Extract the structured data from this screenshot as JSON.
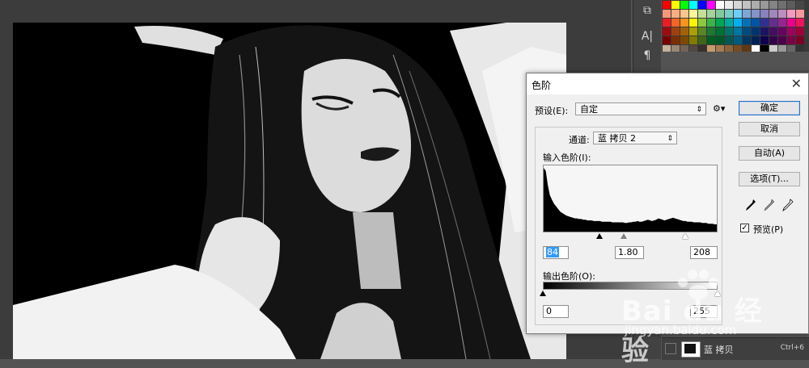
{
  "dialog": {
    "title": "色阶",
    "preset_label": "预设(E):",
    "preset_value": "自定",
    "channel_label": "通道:",
    "channel_value": "蓝 拷贝 2",
    "input_levels_label": "输入色阶(I):",
    "input_black": "84",
    "input_gamma": "1.80",
    "input_white": "208",
    "output_levels_label": "输出色阶(O):",
    "output_black": "0",
    "output_white": "255",
    "buttons": {
      "ok": "确定",
      "cancel": "取消",
      "auto": "自动(A)",
      "options": "选项(T)..."
    },
    "preview_label": "预览(P)",
    "preview_checked": true,
    "close_glyph": "✕",
    "gear_glyph": "⚙▾"
  },
  "layer": {
    "name": "蓝 拷贝",
    "shortcut": "Ctrl+6"
  },
  "watermark": {
    "brand": "Bai du 经验",
    "url": "jingyan.baidu.com"
  },
  "tools": {
    "char_icon": "A|",
    "para_icon": "¶"
  },
  "histogram": [
    96,
    92,
    70,
    55,
    48,
    42,
    38,
    34,
    30,
    28,
    26,
    24,
    23,
    22,
    21,
    20,
    20,
    19,
    19,
    18,
    18,
    17,
    17,
    17,
    16,
    16,
    16,
    16,
    15,
    15,
    15,
    15,
    15,
    14,
    14,
    14,
    14,
    14,
    14,
    13,
    13,
    14,
    14,
    15,
    15,
    16,
    15,
    15,
    16,
    17,
    18,
    17,
    16,
    17,
    18,
    20,
    19,
    18,
    17,
    18,
    19,
    20,
    21,
    20,
    19,
    18,
    17,
    16,
    16,
    15,
    15,
    15,
    14,
    14,
    14,
    14,
    13,
    13,
    13,
    12,
    12,
    12,
    11,
    11
  ],
  "swatch_colors": [
    "#ff0000",
    "#ffff00",
    "#00ff00",
    "#00ffff",
    "#0000ff",
    "#ff00ff",
    "#ffffff",
    "#ebebeb",
    "#d6d6d6",
    "#c2c2c2",
    "#adadad",
    "#999999",
    "#858585",
    "#707070",
    "#5c5c5c",
    "#474747",
    "#f7977a",
    "#f9ad81",
    "#fdc68a",
    "#fff79a",
    "#c4df9b",
    "#a2d39c",
    "#82ca9d",
    "#7bcdc8",
    "#6ecff6",
    "#7ea7d8",
    "#8493ca",
    "#8882be",
    "#a187be",
    "#bc8dbf",
    "#f49ac2",
    "#f6989d",
    "#ed1c24",
    "#f26522",
    "#f7941d",
    "#fff200",
    "#8dc63f",
    "#39b54a",
    "#00a651",
    "#00a99d",
    "#00aeef",
    "#0072bc",
    "#0054a6",
    "#2e3192",
    "#662d91",
    "#92278f",
    "#ec008c",
    "#ed145b",
    "#9e0b0f",
    "#a0410d",
    "#a36209",
    "#aba000",
    "#598527",
    "#1a7b30",
    "#007236",
    "#00746b",
    "#0076a3",
    "#004b80",
    "#003471",
    "#1b1464",
    "#440e62",
    "#630460",
    "#9e005d",
    "#9e0039",
    "#790000",
    "#7b2e00",
    "#7d4900",
    "#827b00",
    "#406618",
    "#005e20",
    "#005826",
    "#005952",
    "#005b7f",
    "#003663",
    "#002157",
    "#0d004c",
    "#32004b",
    "#4b0049",
    "#7b0046",
    "#7a0026",
    "#c7b299",
    "#998675",
    "#736357",
    "#534741",
    "#37302d",
    "#c69c6d",
    "#a67c52",
    "#8c6239",
    "#754c24",
    "#603913",
    "#ffffff",
    "#000000",
    "#cccccc",
    "#999999",
    "#666666",
    "#333333"
  ]
}
